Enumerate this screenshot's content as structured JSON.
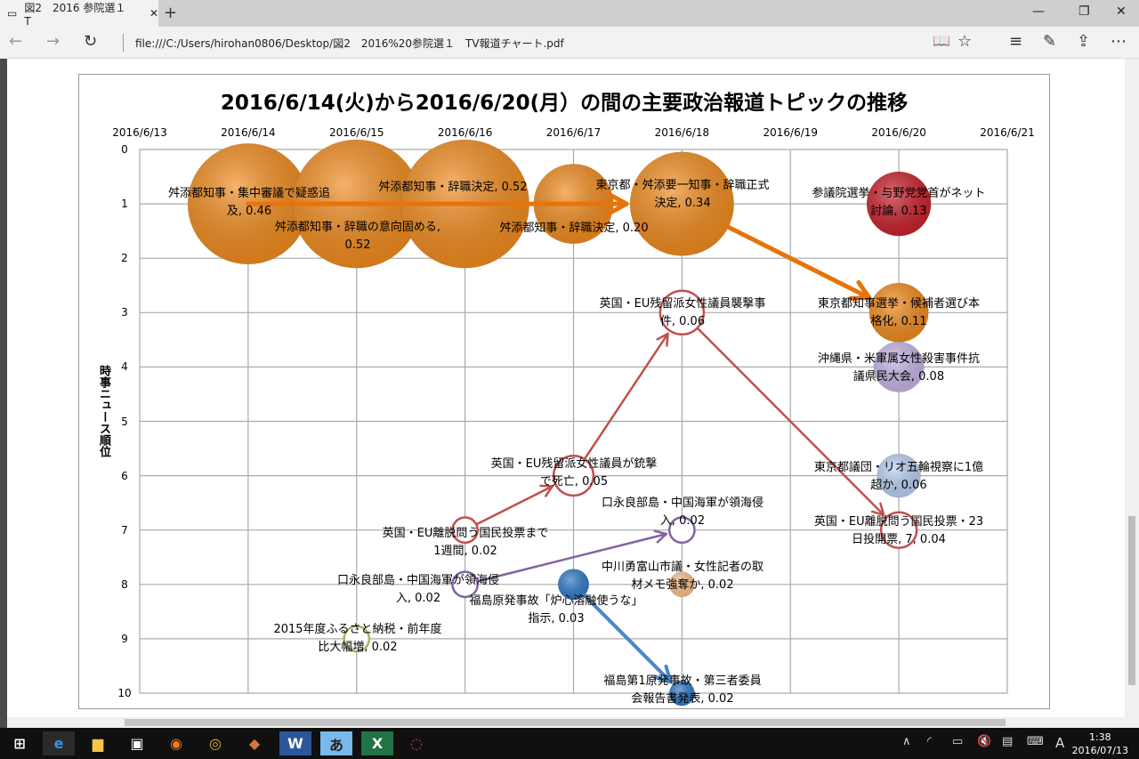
{
  "browser": {
    "tab_title": "図2　2016 参院選１　T",
    "url": "file:///C:/Users/hirohan0806/Desktop/図2　2016%20参院選１　TV報道チャート.pdf"
  },
  "taskbar": {
    "time": "1:38",
    "date": "2016/07/13",
    "ime": "A"
  },
  "chart_data": {
    "type": "scatter",
    "title": "2016/6/14(火)から2016/6/20(月）の間の主要政治報道トピックの推移",
    "ylabel": "時事ニュース順位",
    "x_ticks": [
      "2016/6/13",
      "2016/6/14",
      "2016/6/15",
      "2016/6/16",
      "2016/6/17",
      "2016/6/18",
      "2016/6/19",
      "2016/6/20",
      "2016/6/21"
    ],
    "y_ticks": [
      "0",
      "1",
      "2",
      "3",
      "4",
      "5",
      "6",
      "7",
      "8",
      "9",
      "10"
    ],
    "xlim": [
      0,
      8
    ],
    "ylim": [
      0,
      10
    ],
    "grid": true,
    "points": [
      {
        "day": 1,
        "rank": 1,
        "size": 0.46,
        "color": "#f08a1c",
        "filled": true,
        "label": "舛添都知事・集中審議で疑惑追\n及, 0.46"
      },
      {
        "day": 2,
        "rank": 1,
        "size": 0.52,
        "color": "#f08a1c",
        "filled": true,
        "label": "舛添都知事・辞職の意向固める,\n0.52"
      },
      {
        "day": 3,
        "rank": 1,
        "size": 0.52,
        "color": "#f08a1c",
        "filled": true,
        "label": "舛添都知事・辞職決定, 0.52"
      },
      {
        "day": 4,
        "rank": 1,
        "size": 0.2,
        "color": "#f08a1c",
        "filled": true,
        "label": "舛添都知事・辞職決定, 0.20"
      },
      {
        "day": 5,
        "rank": 1,
        "size": 0.34,
        "color": "#f08a1c",
        "filled": true,
        "label": "東京都・舛添要一知事・辞職正式\n決定, 0.34"
      },
      {
        "day": 7,
        "rank": 1,
        "size": 0.13,
        "color": "#c8202a",
        "filled": true,
        "label": "参議院選挙・与野党党首がネット\n討論, 0.13"
      },
      {
        "day": 7,
        "rank": 3,
        "size": 0.11,
        "color": "#f08a1c",
        "filled": true,
        "label": "東京都知事選挙・候補者選び本\n格化, 0.11"
      },
      {
        "day": 7,
        "rank": 4,
        "size": 0.08,
        "color": "#c6b4e4",
        "filled": true,
        "label": "沖縄県・米軍属女性殺害事件抗\n議県民大会, 0.08"
      },
      {
        "day": 7,
        "rank": 6,
        "size": 0.06,
        "color": "#b8cff0",
        "filled": true,
        "label": "東京都議団・リオ五輪視察に1億\n超か, 0.06"
      },
      {
        "day": 7,
        "rank": 7,
        "size": 0.04,
        "color": "#c0504d",
        "filled": false,
        "label": "英国・EU離脱問う国民投票・23\n日投開票, 7, 0.04"
      },
      {
        "day": 5,
        "rank": 3,
        "size": 0.06,
        "color": "#c0504d",
        "filled": false,
        "label": "英国・EU残留派女性議員襲撃事\n件, 0.06"
      },
      {
        "day": 4,
        "rank": 6,
        "size": 0.05,
        "color": "#c0504d",
        "filled": false,
        "label": "英国・EU残留派女性議員が銃撃\nで死亡, 0.05"
      },
      {
        "day": 3,
        "rank": 7,
        "size": 0.02,
        "color": "#c0504d",
        "filled": false,
        "label": "英国・EU離脱問う国民投票まで\n1週間, 0.02"
      },
      {
        "day": 3,
        "rank": 8,
        "size": 0.02,
        "color": "#8064a2",
        "filled": false,
        "label": "口永良部島・中国海軍が領海侵\n入, 0.02"
      },
      {
        "day": 5,
        "rank": 7,
        "size": 0.02,
        "color": "#8064a2",
        "filled": false,
        "label": "口永良部島・中国海軍が領海侵\n入, 0.02"
      },
      {
        "day": 4,
        "rank": 8,
        "size": 0.03,
        "color": "#2f78c8",
        "filled": true,
        "label": "福島原発事故「炉心溶融使うな」\n指示, 0.03"
      },
      {
        "day": 5,
        "rank": 8,
        "size": 0.02,
        "color": "#fbbf8a",
        "filled": true,
        "label": "中川勇富山市議・女性記者の取\n材メモ強奪か, 0.02"
      },
      {
        "day": 2,
        "rank": 9,
        "size": 0.02,
        "color": "#9bbb59",
        "filled": false,
        "label": "2015年度ふるさと納税・前年度\n比大幅増, 0.02"
      },
      {
        "day": 5,
        "rank": 10,
        "size": 0.02,
        "color": "#2f78c8",
        "filled": true,
        "label": "福島第1原発事故・第三者委員\n会報告書発表, 0.02"
      }
    ],
    "arrows": [
      {
        "from": [
          1,
          1
        ],
        "to": [
          5,
          1
        ],
        "color": "#e8730a"
      },
      {
        "from": [
          5,
          1
        ],
        "to": [
          7,
          3
        ],
        "color": "#e8730a"
      },
      {
        "from": [
          3,
          7
        ],
        "to": [
          4,
          6
        ],
        "color": "#c0504d"
      },
      {
        "from": [
          4,
          6
        ],
        "to": [
          5,
          3
        ],
        "color": "#c0504d"
      },
      {
        "from": [
          5,
          3
        ],
        "to": [
          7,
          7
        ],
        "color": "#c0504d"
      },
      {
        "from": [
          3,
          8
        ],
        "to": [
          5,
          7
        ],
        "color": "#8064a2"
      },
      {
        "from": [
          4,
          8
        ],
        "to": [
          5,
          10
        ],
        "color": "#4a86c8"
      }
    ]
  }
}
